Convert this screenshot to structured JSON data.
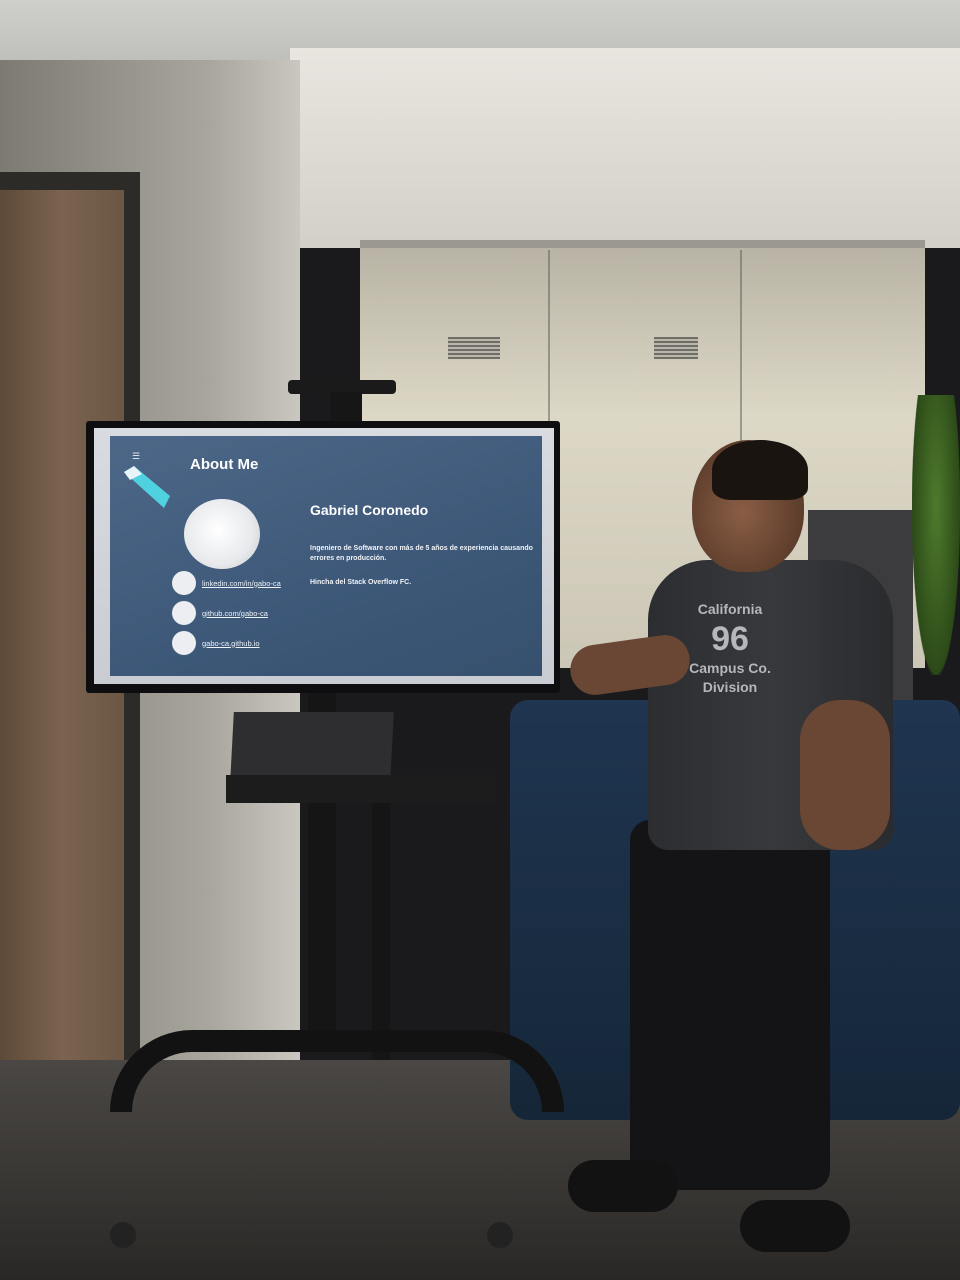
{
  "screen": {
    "menu_icon": "hamburger-icon",
    "about_title": "About Me",
    "name": "Gabriel Coronedo",
    "bio_1": "Ingeniero de Software con más de 5 años de experiencia causando errores en producción.",
    "bio_2": "Hincha del Stack Overflow FC.",
    "links": [
      {
        "icon": "linkedin-icon",
        "label": "linkedin.com/in/gabo-ca"
      },
      {
        "icon": "github-icon",
        "label": "github.com/gabo-ca"
      },
      {
        "icon": "globe-icon",
        "label": "gabo-ca.github.io"
      }
    ],
    "accent_color": "#4fd1e0",
    "background_color": "#44607f"
  },
  "shirt_print": [
    "California",
    "96",
    "Campus Co.",
    "Division"
  ]
}
